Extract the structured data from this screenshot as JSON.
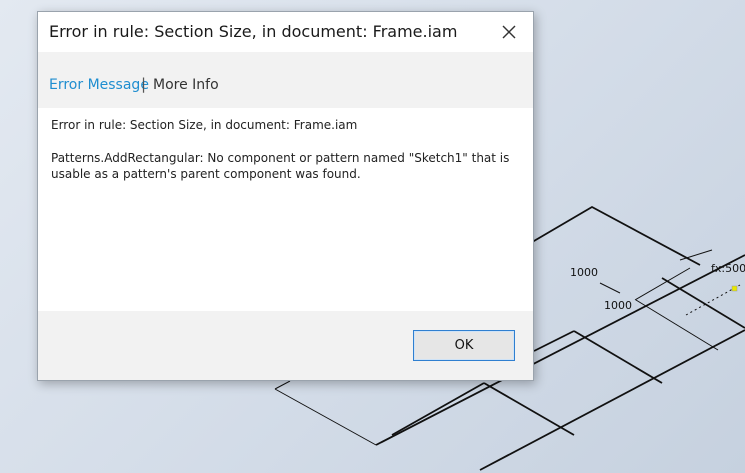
{
  "dialog": {
    "title": "Error in rule: Section Size, in document: Frame.iam",
    "tabs": [
      {
        "label": "Error Message",
        "active": true
      },
      {
        "label": "More Info",
        "active": false
      }
    ],
    "tab_separator": "|",
    "message_line1": "Error in rule: Section Size, in document: Frame.iam",
    "message_line2": "Patterns.AddRectangular: No component or pattern named \"Sketch1\" that is usable as a pattern's parent component was found.",
    "ok_label": "OK",
    "close_icon": "close-icon"
  },
  "canvas": {
    "dimension_labels": [
      "1000",
      "1000",
      "fx:500"
    ],
    "accent_colors": {
      "link": "#1f8ed0",
      "ok_border": "#2f7fd0",
      "marker": "#e8e800"
    }
  }
}
